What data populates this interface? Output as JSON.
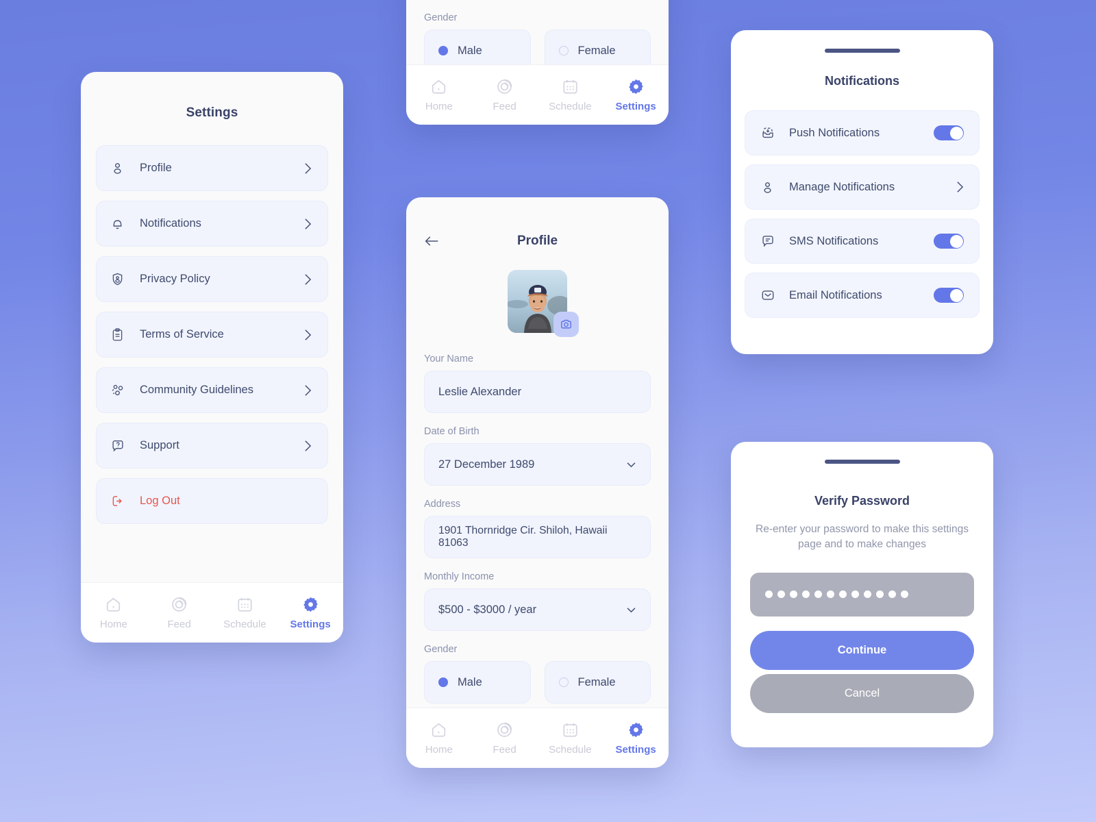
{
  "theme": {
    "bg_top": "#6a7ee0",
    "bg_bottom": "#c2cbfa",
    "accent": "#6377e8",
    "danger": "#e8554e",
    "text_dark": "#3a4268",
    "text_muted": "#8b92ad",
    "row_bg": "#f1f4fd"
  },
  "settings_screen": {
    "title": "Settings",
    "items": [
      {
        "label": "Profile",
        "icon": "user-icon"
      },
      {
        "label": "Notifications",
        "icon": "bell-icon"
      },
      {
        "label": "Privacy Policy",
        "icon": "shield-user-icon"
      },
      {
        "label": "Terms of Service",
        "icon": "clipboard-icon"
      },
      {
        "label": "Community Guidelines",
        "icon": "community-icon"
      },
      {
        "label": "Support",
        "icon": "question-chat-icon"
      },
      {
        "label": "Log Out",
        "icon": "logout-icon"
      }
    ]
  },
  "bottom_nav": {
    "items": [
      {
        "label": "Home",
        "icon": "home-icon",
        "active": false
      },
      {
        "label": "Feed",
        "icon": "feed-icon",
        "active": false
      },
      {
        "label": "Schedule",
        "icon": "calendar-icon",
        "active": false
      },
      {
        "label": "Settings",
        "icon": "gear-icon",
        "active": true
      }
    ]
  },
  "profile_screen": {
    "title": "Profile",
    "back_icon": "arrow-left-icon",
    "avatar_badge_icon": "camera-icon",
    "fields": [
      {
        "label": "Your Name",
        "value": "Leslie Alexander",
        "type": "text"
      },
      {
        "label": "Date of Birth",
        "value": "27 December 1989",
        "type": "select"
      },
      {
        "label": "Address",
        "value": "1901 Thornridge Cir. Shiloh, Hawaii 81063",
        "type": "text"
      },
      {
        "label": "Monthly Income",
        "value": "$500 - $3000 / year",
        "type": "select"
      }
    ],
    "gender": {
      "label": "Gender",
      "options": [
        {
          "label": "Male",
          "selected": true
        },
        {
          "label": "Female",
          "selected": false
        }
      ]
    }
  },
  "notifications_sheet": {
    "title": "Notifications",
    "rows": [
      {
        "label": "Push Notifications",
        "icon": "push-inbox-icon",
        "control": "toggle",
        "on": true
      },
      {
        "label": "Manage Notifications",
        "icon": "user-icon",
        "control": "chevron",
        "on": false
      },
      {
        "label": "SMS  Notifications",
        "icon": "message-icon",
        "control": "toggle",
        "on": true
      },
      {
        "label": "Email  Notifications",
        "icon": "mail-icon",
        "control": "toggle",
        "on": true
      }
    ]
  },
  "verify_password_sheet": {
    "title": "Verify Password",
    "subtitle": "Re-enter your password to make this settings page and to make changes",
    "password_masked_length": 12,
    "continue_label": "Continue",
    "cancel_label": "Cancel"
  }
}
